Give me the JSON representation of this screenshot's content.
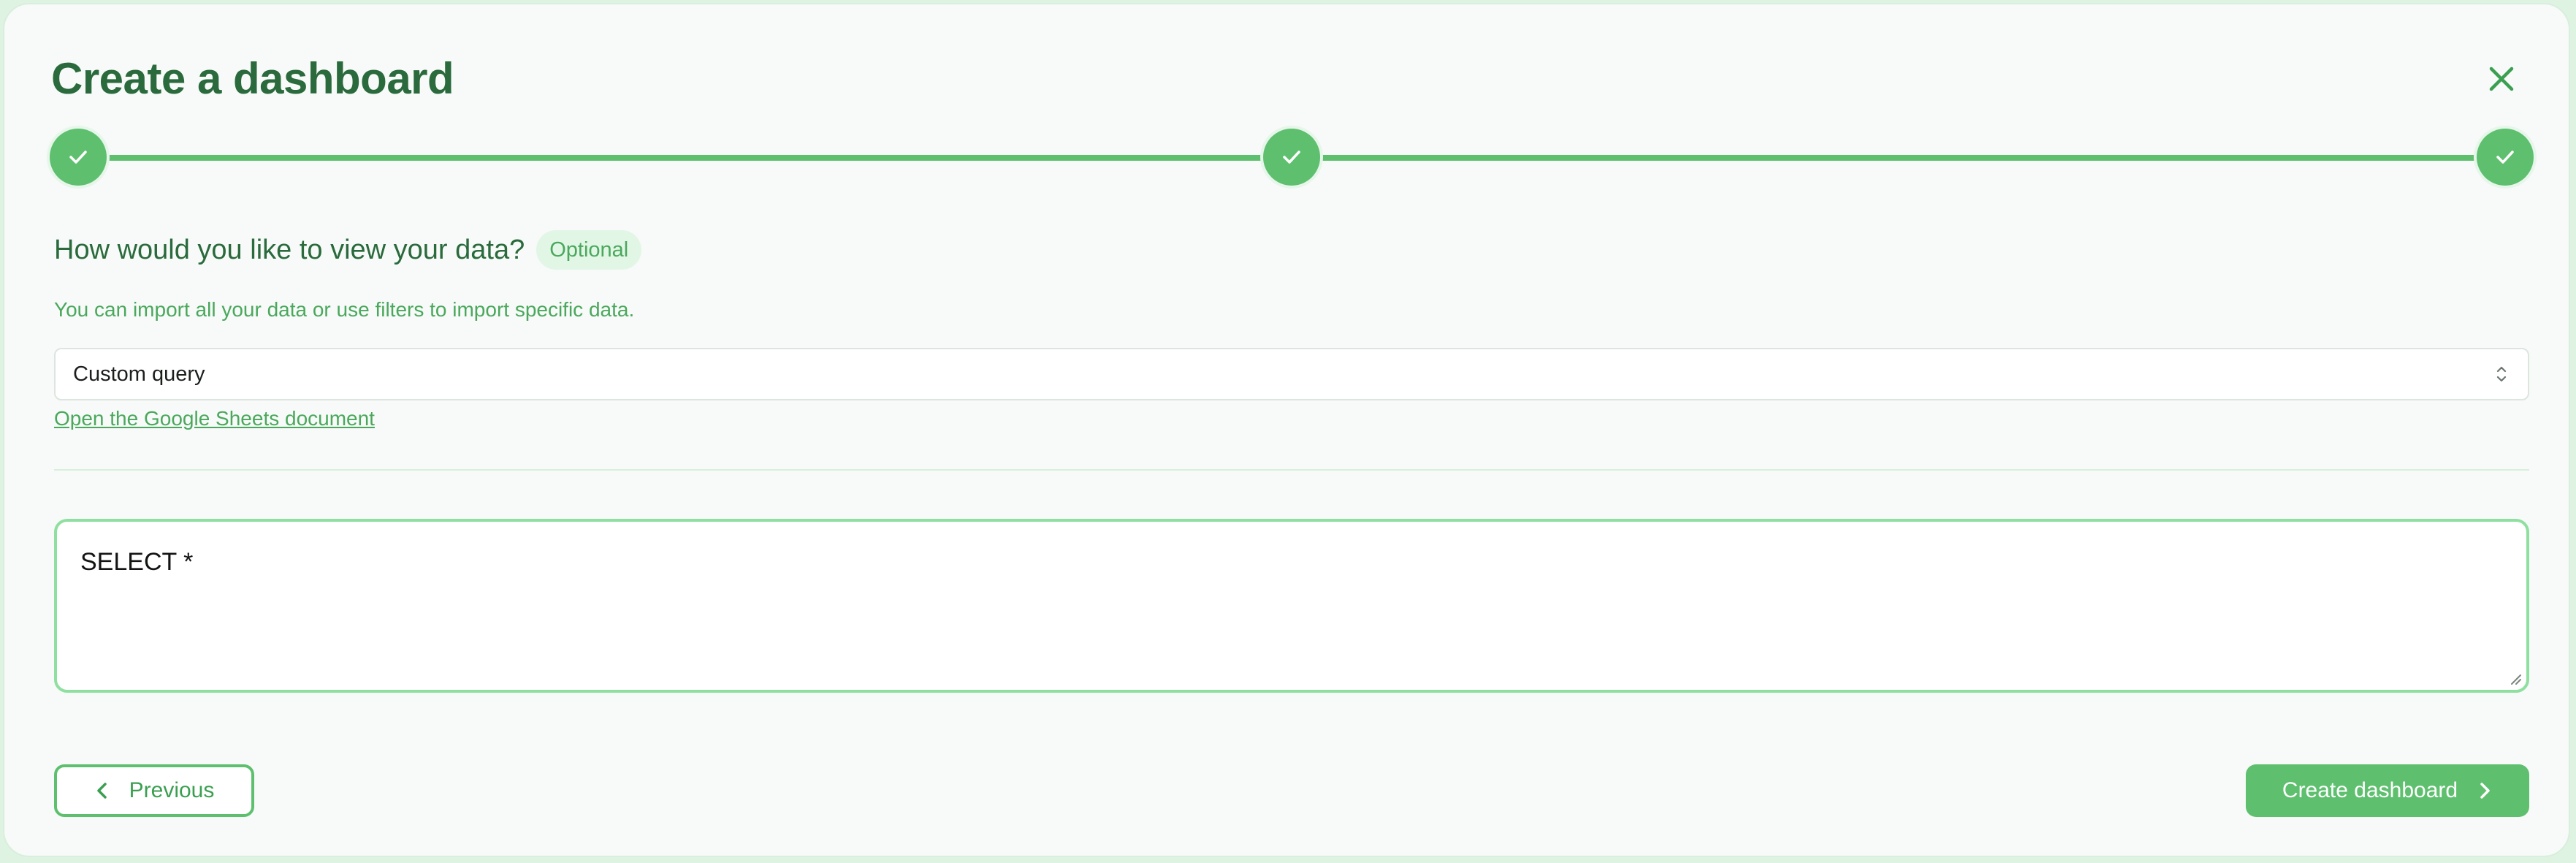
{
  "modal": {
    "title": "Create a dashboard",
    "close_icon": "close-icon"
  },
  "stepper": {
    "steps": [
      {
        "state": "complete",
        "icon": "check-icon"
      },
      {
        "state": "complete",
        "icon": "check-icon"
      },
      {
        "state": "complete",
        "icon": "check-icon"
      }
    ]
  },
  "form": {
    "question": "How would you like to view your data?",
    "optional_badge": "Optional",
    "helper": "You can import all your data or use filters to import specific data.",
    "view_select": {
      "selected": "Custom query",
      "icon": "chevron-updown-icon"
    },
    "sheet_link": "Open the Google Sheets document",
    "query": "SELECT *"
  },
  "footer": {
    "previous_label": "Previous",
    "create_label": "Create dashboard"
  },
  "colors": {
    "accent": "#5ec06e",
    "title": "#2a6a3c",
    "text_green": "#4aa85c",
    "editor_border": "#8fe0a0"
  }
}
